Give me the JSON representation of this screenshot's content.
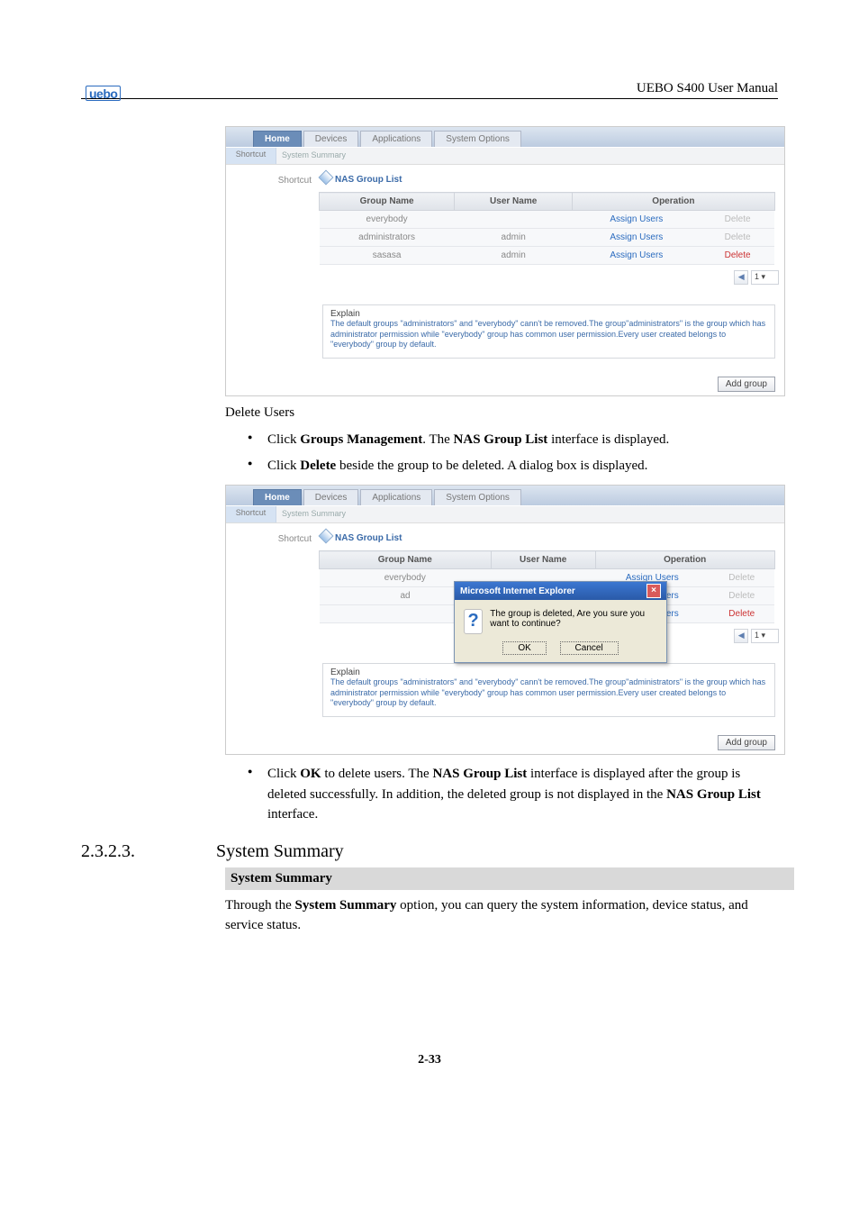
{
  "header": {
    "logo": "uebo",
    "right": "UEBO S400 User Manual"
  },
  "screenshot_common": {
    "tabs": [
      "Home",
      "Devices",
      "Applications",
      "System Options"
    ],
    "shortcutLabel": "Shortcut",
    "systemSummaryLabel": "System Summary",
    "nasGroupListTitle": "NAS Group List",
    "columns": {
      "group": "Group Name",
      "user": "User Name",
      "op": "Operation"
    },
    "assignLabel": "Assign Users",
    "deleteLabel": "Delete",
    "addGroupLabel": "Add group",
    "explainTitle": "Explain",
    "explainText": "The default groups \"administrators\" and \"everybody\" cann't be removed.The group\"administrators\" is the group which has administrator permission while \"everybody\" group has common user permission.Every user created belongs to \"everybody\" group by default.",
    "pageNum": "1"
  },
  "screenshot1": {
    "rows": [
      {
        "group": "everybody",
        "user": "",
        "delDisabled": true
      },
      {
        "group": "administrators",
        "user": "admin",
        "delDisabled": true
      },
      {
        "group": "sasasa",
        "user": "admin",
        "delDisabled": false
      }
    ]
  },
  "screenshot2": {
    "rows": [
      {
        "group": "everybody",
        "user": "",
        "delDisabled": true
      },
      {
        "group": "ad",
        "user": "",
        "delDisabled": true
      },
      {
        "group": "",
        "user": "",
        "delDisabled": false
      }
    ],
    "dialog": {
      "title": "Microsoft Internet Explorer",
      "message": "The group is deleted, Are you sure you want to continue?",
      "ok": "OK",
      "cancel": "Cancel"
    }
  },
  "doc": {
    "deleteUsers": "Delete Users",
    "bullets1": {
      "a_pre": "Click ",
      "a_b1": "Groups Management",
      "a_mid": ". The ",
      "a_b2": "NAS Group List",
      "a_post": " interface is displayed.",
      "b_pre": "Click ",
      "b_b1": "Delete",
      "b_post": " beside the group to be deleted. A dialog box is displayed."
    },
    "bullets2": {
      "pre": "Click ",
      "b1": "OK",
      "mid1": " to delete users. The ",
      "b2": "NAS Group List",
      "mid2": " interface is displayed after the group is deleted successfully. In addition, the deleted group is not displayed in the ",
      "b3": "NAS Group List",
      "post": " interface."
    },
    "sectionNum": "2.3.2.3.",
    "sectionTitle": "System Summary",
    "greyTitle": "System Summary",
    "summaryText_pre": "Through the ",
    "summaryText_b": "System Summary",
    "summaryText_post": " option, you can query the system information, device status, and service status.",
    "footer": "2-33"
  }
}
